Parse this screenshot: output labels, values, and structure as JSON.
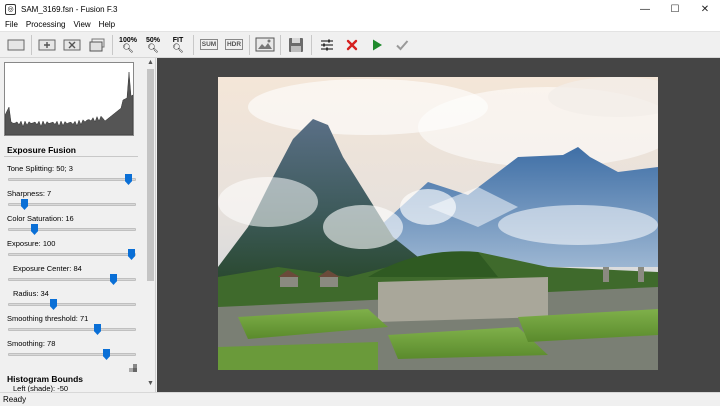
{
  "window": {
    "title": "SAM_3169.fsn - Fusion F.3",
    "minimize_icon": "minimize-icon",
    "maximize_icon": "maximize-icon",
    "close_icon": "close-icon"
  },
  "menu": [
    "File",
    "Processing",
    "View",
    "Help"
  ],
  "toolbar": {
    "zoom100": "100%",
    "zoom50": "50%",
    "fit": "FIT",
    "sum": "SUM",
    "hdr": "HDR"
  },
  "panel": {
    "section_title": "Exposure Fusion",
    "controls": [
      {
        "label": "Tone Splitting: 50; 3",
        "value": 0.97
      },
      {
        "label": "Sharpness: 7",
        "value": 0.1
      },
      {
        "label": "Color Saturation: 16",
        "value": 0.18
      },
      {
        "label": "Exposure: 100",
        "value": 0.99
      },
      {
        "label": "Exposure Center: 84",
        "value": 0.84
      },
      {
        "label": "Radius: 34",
        "value": 0.34
      },
      {
        "label": "Smoothing threshold: 71",
        "value": 0.71
      },
      {
        "label": "Smoothing: 78",
        "value": 0.78
      }
    ],
    "histogram_bounds_title": "Histogram Bounds",
    "histogram_bounds_left": "Left (shade): -50"
  },
  "status": "Ready",
  "colors": {
    "accent": "#0a6fd6",
    "viewer_bg": "#454545",
    "cancel_red": "#d6201f",
    "run_green": "#1f8a2c"
  }
}
